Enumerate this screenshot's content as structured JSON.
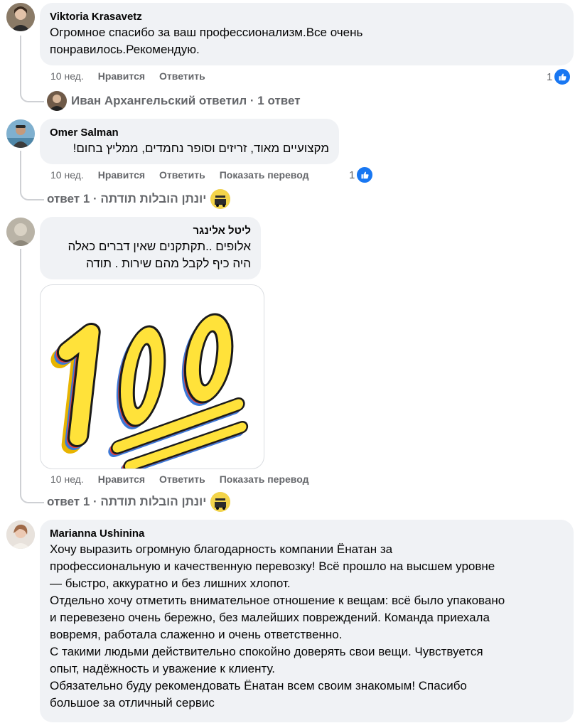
{
  "colors": {
    "bubble": "#f0f2f5",
    "meta_text": "#65676b",
    "like_blue": "#1877f2",
    "thread_line": "#ced0d4"
  },
  "comments": [
    {
      "author": "Viktoria Krasavetz",
      "lines": [
        "Огромное спасибо за ваш профессионализм.Все очень",
        "понравилось.Рекомендую."
      ],
      "time": "10 нед.",
      "like_label": "Нравится",
      "reply_label": "Ответить",
      "reaction_count": "1",
      "reaction_icon": "thumbs-up-icon",
      "replies_text": "Иван Архангельский ответил · 1 ответ"
    },
    {
      "author": "Omer Salman",
      "lines": [
        "מקצועיים מאוד, זריזים וסופר נחמדים, ממליץ בחום!"
      ],
      "time": "10 нед.",
      "like_label": "Нравится",
      "reply_label": "Ответить",
      "translate_label": "Показать перевод",
      "reaction_count": "1",
      "reaction_icon": "thumbs-up-icon",
      "replies_text": "יונתן הובלות תודתה · 1 ответ"
    },
    {
      "author": "ליטל אלינגר",
      "lines": [
        "אלופים ..תקתקנים שאין דברים כאלה",
        "היה כיף לקבל מהם שירות . תודה"
      ],
      "sticker": "100",
      "sticker_icon": "hundred-points-sticker",
      "time": "10 нед.",
      "like_label": "Нравится",
      "reply_label": "Ответить",
      "translate_label": "Показать перевод",
      "replies_text": "יונתן הובלות תודתה · 1 ответ"
    },
    {
      "author": "Marianna Ushinina",
      "lines": [
        "Хочу выразить огромную благодарность компании Ёнатан за",
        "профессиональную и качественную перевозку! Всё прошло на высшем уровне",
        "— быстро, аккуратно и без лишних хлопот.",
        "Отдельно хочу отметить внимательное отношение к вещам: всё было упаковано",
        "и перевезено очень бережно, без малейших повреждений. Команда приехала",
        "вовремя, работала слаженно и очень ответственно.",
        "С такими людьми действительно спокойно доверять свои вещи. Чувствуется",
        "опыт, надёжность и уважение к клиенту.",
        "Обязательно буду рекомендовать Ёнатан всем своим знакомым! Спасибо",
        "большое за отличный сервис"
      ]
    }
  ]
}
